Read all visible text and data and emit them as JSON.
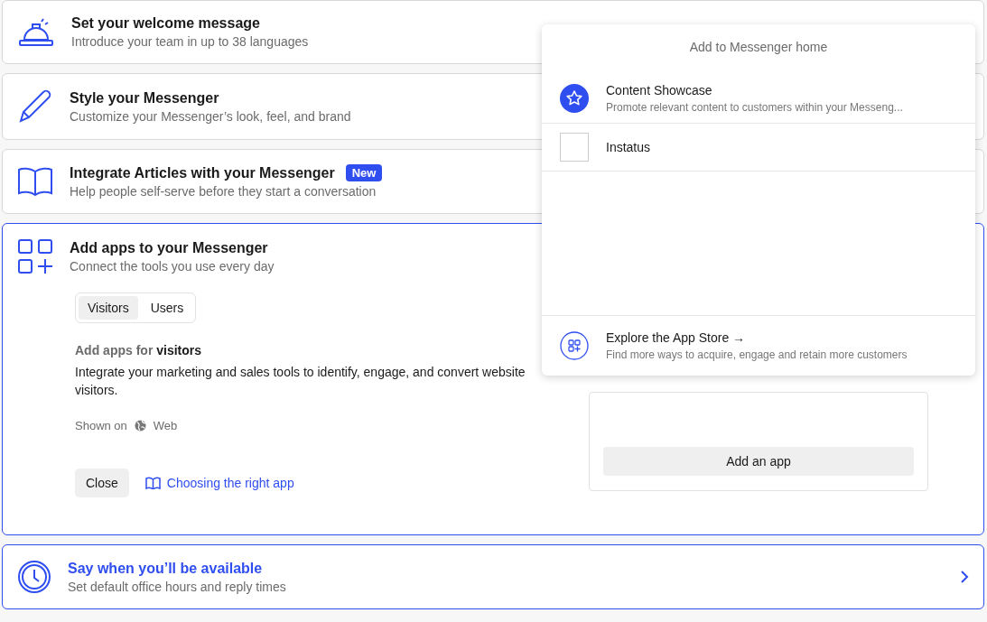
{
  "cards": [
    {
      "kind": "bell",
      "title": "Set your welcome message",
      "subtitle": "Introduce your team in up to 38 languages",
      "highlighted": false,
      "expanded": false
    },
    {
      "kind": "pencil",
      "title": "Style your Messenger",
      "subtitle": "Customize your Messenger’s look, feel, and brand",
      "highlighted": false,
      "expanded": false
    },
    {
      "kind": "book",
      "title": "Integrate Articles with your Messenger",
      "badge": "New",
      "subtitle": "Help people self-serve before they start a conversation",
      "highlighted": false,
      "expanded": false
    },
    {
      "kind": "apps",
      "title": "Add apps to your Messenger",
      "subtitle": "Connect the tools you use every day",
      "highlighted": true,
      "expanded": true
    },
    {
      "kind": "clock",
      "title": "Say when you’ll be available",
      "subtitle": "Set default office hours and reply times",
      "highlighted": true,
      "expanded": false
    }
  ],
  "apps_panel": {
    "tabs": [
      {
        "label": "Visitors",
        "selected": true
      },
      {
        "label": "Users",
        "selected": false
      }
    ],
    "heading": "Add apps for **visitors**",
    "description": "Integrate your marketing and sales tools to identify, engage, and convert website visitors.",
    "shown_on_label": "Shown on",
    "shown_on_value": "Web",
    "close_button": "Close",
    "help_link": "Choosing the right app",
    "add_button": "Add an app"
  },
  "popover": {
    "title": "Add to Messenger home",
    "items": [
      {
        "kind": "star",
        "name": "Content Showcase",
        "description": "Promote relevant content to customers within your Messeng..."
      },
      {
        "kind": "blank",
        "name": "Instatus"
      }
    ],
    "footer": {
      "title": "Explore the App Store →",
      "description": "Find more ways to acquire, engage and retain more customers"
    }
  }
}
